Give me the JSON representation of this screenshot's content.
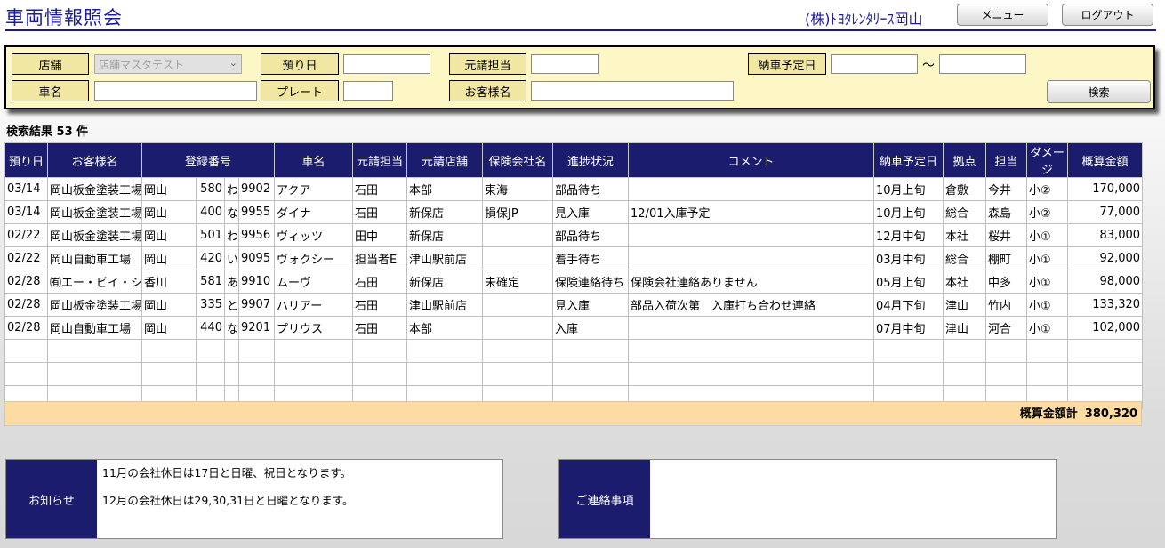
{
  "header": {
    "title": "車両情報照会",
    "company": "(株)ﾄﾖﾀﾚﾝﾀﾘｰｽ岡山",
    "menu_label": "メニュー",
    "logout_label": "ログアウト"
  },
  "search": {
    "store_label": "店舗",
    "store_value": "店舗マスタテスト",
    "deposit_date_label": "預り日",
    "deposit_date_value": "",
    "orig_staff_label": "元請担当",
    "orig_staff_value": "",
    "delivery_date_label": "納車予定日",
    "delivery_from": "",
    "tilde": "～",
    "delivery_to": "",
    "car_name_label": "車名",
    "car_name_value": "",
    "plate_label": "プレート",
    "plate_value": "",
    "customer_label": "お客様名",
    "customer_value": "",
    "search_button": "検索"
  },
  "results": {
    "count_label": "検索結果 53 件"
  },
  "table": {
    "headers": [
      "預り日",
      "お客様名",
      "登録番号",
      "車名",
      "元請担当",
      "元請店舗",
      "保険会社名",
      "進捗状況",
      "コメント",
      "納車予定日",
      "拠点",
      "担当",
      "ダメージ",
      "概算金額"
    ],
    "rows": [
      {
        "date": "03/14",
        "customer": "岡山板金塗装工場",
        "reg_area": "岡山",
        "reg_class": "580",
        "reg_kana": "わ",
        "reg_num": "9902",
        "car": "アクア",
        "staff": "石田",
        "store": "本部",
        "insurer": "東海",
        "progress": "部品待ち",
        "comment": "",
        "delivery": "10月上旬",
        "base": "倉敷",
        "person": "今井",
        "damage": "小②",
        "amount": "170,000"
      },
      {
        "date": "03/14",
        "customer": "岡山板金塗装工場",
        "reg_area": "岡山",
        "reg_class": "400",
        "reg_kana": "な",
        "reg_num": "9955",
        "car": "ダイナ",
        "staff": "石田",
        "store": "新保店",
        "insurer": "損保JP",
        "progress": "見入庫",
        "comment": "12/01入庫予定",
        "delivery": "10月上旬",
        "base": "総合",
        "person": "森島",
        "damage": "小②",
        "amount": "77,000"
      },
      {
        "date": "02/22",
        "customer": "岡山板金塗装工場",
        "reg_area": "岡山",
        "reg_class": "501",
        "reg_kana": "わ",
        "reg_num": "9956",
        "car": "ヴィッツ",
        "staff": "田中",
        "store": "新保店",
        "insurer": "",
        "progress": "部品待ち",
        "comment": "",
        "delivery": "12月中旬",
        "base": "本社",
        "person": "桜井",
        "damage": "小①",
        "amount": "83,000"
      },
      {
        "date": "02/22",
        "customer": "岡山自動車工場",
        "reg_area": "岡山",
        "reg_class": "420",
        "reg_kana": "い",
        "reg_num": "9095",
        "car": "ヴォクシー",
        "staff": "担当者E",
        "store": "津山駅前店",
        "insurer": "",
        "progress": "着手待ち",
        "comment": "",
        "delivery": "03月中旬",
        "base": "総合",
        "person": "棚町",
        "damage": "小①",
        "amount": "92,000"
      },
      {
        "date": "02/28",
        "customer": "㈲エー・ビイ・シー",
        "reg_area": "香川",
        "reg_class": "581",
        "reg_kana": "あ",
        "reg_num": "9910",
        "car": "ムーヴ",
        "staff": "石田",
        "store": "新保店",
        "insurer": "未確定",
        "progress": "保険連絡待ち",
        "comment": "保険会社連絡ありません",
        "delivery": "05月上旬",
        "base": "本社",
        "person": "中多",
        "damage": "小①",
        "amount": "98,000"
      },
      {
        "date": "02/28",
        "customer": "岡山板金塗装工場",
        "reg_area": "岡山",
        "reg_class": "335",
        "reg_kana": "と",
        "reg_num": "9907",
        "car": "ハリアー",
        "staff": "石田",
        "store": "津山駅前店",
        "insurer": "",
        "progress": "見入庫",
        "comment": "部品入荷次第　入庫打ち合わせ連絡",
        "delivery": "04月下旬",
        "base": "津山",
        "person": "竹内",
        "damage": "小①",
        "amount": "133,320"
      },
      {
        "date": "02/28",
        "customer": "岡山自動車工場",
        "reg_area": "岡山",
        "reg_class": "440",
        "reg_kana": "な",
        "reg_num": "9201",
        "car": "プリウス",
        "staff": "石田",
        "store": "本部",
        "insurer": "",
        "progress": "入庫",
        "comment": "",
        "delivery": "07月中旬",
        "base": "津山",
        "person": "河合",
        "damage": "小①",
        "amount": "102,000"
      }
    ],
    "total_label": "概算金額計",
    "total_value": "380,320"
  },
  "notice": {
    "title": "お知らせ",
    "lines": [
      "11月の会社休日は17日と日曜、祝日となります。",
      "12月の会社休日は29,30,31日と日曜となります。"
    ]
  },
  "contact": {
    "title": "ご連絡事項",
    "text": ""
  }
}
